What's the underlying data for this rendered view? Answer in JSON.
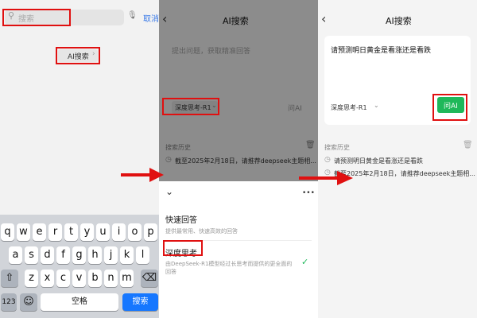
{
  "panel1": {
    "search_placeholder": "搜索",
    "cancel": "取消",
    "ai_search_chip": "AI搜索",
    "keyboard": {
      "row1": [
        "q",
        "w",
        "e",
        "r",
        "t",
        "y",
        "u",
        "i",
        "o",
        "p"
      ],
      "row2": [
        "a",
        "s",
        "d",
        "f",
        "g",
        "h",
        "j",
        "k",
        "l"
      ],
      "row3": [
        "z",
        "x",
        "c",
        "v",
        "b",
        "n",
        "m"
      ],
      "num": "123",
      "space": "空格",
      "search": "搜索"
    }
  },
  "panel2": {
    "title": "AI搜索",
    "input_placeholder": "提出问题，获取精准回答",
    "mode": "深度思考-R1",
    "ask": "问AI",
    "history_label": "搜索历史",
    "history": [
      "截至2025年2月18日，请推荐deepseek主题相..."
    ],
    "sheet": {
      "more": "•••",
      "options": [
        {
          "title": "快速回答",
          "desc": "提供最常用、快速高效的回答"
        },
        {
          "title": "深度思考",
          "desc": "由DeepSeek-R1模型经过长思考而提供的更全面的回答"
        }
      ]
    }
  },
  "panel3": {
    "title": "AI搜索",
    "query": "请预测明日黄金是看涨还是看跌",
    "mode": "深度思考-R1",
    "ask": "问AI",
    "history_label": "搜索历史",
    "history": [
      "请预测明日黄金是看涨还是看跌",
      "截至2025年2月18日，请推荐deepseek主题相..."
    ]
  },
  "colors": {
    "highlight": "#e01010",
    "accent_green": "#1fb85a",
    "key_blue": "#1677ff"
  }
}
